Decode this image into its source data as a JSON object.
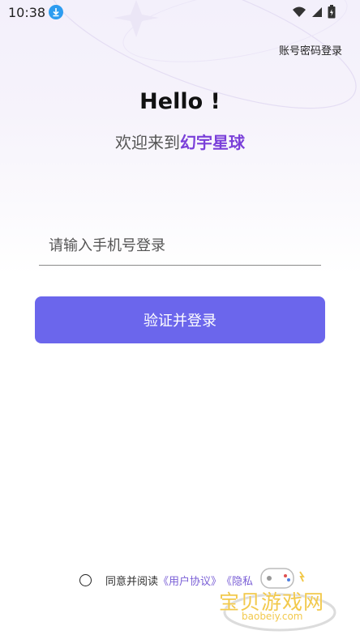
{
  "status_bar": {
    "time": "10:38",
    "icons": [
      "download-icon",
      "wifi-icon",
      "signal-icon",
      "battery-icon"
    ]
  },
  "header": {
    "password_login": "账号密码登录"
  },
  "hero": {
    "hello": "Hello !",
    "welcome_prefix": "欢迎来到",
    "brand": "幻宇星球"
  },
  "form": {
    "phone_placeholder": "请输入手机号登录",
    "phone_value": "",
    "submit_label": "验证并登录"
  },
  "agreement": {
    "prefix": "同意并阅读",
    "user_agreement": "《用户协议》",
    "privacy": "《隐私"
  },
  "watermark": {
    "text": "宝贝游戏网",
    "url": "baobeiy.com"
  },
  "colors": {
    "accent": "#6b66ec",
    "brand": "#7a3fd9",
    "link": "#7a5fd6"
  }
}
